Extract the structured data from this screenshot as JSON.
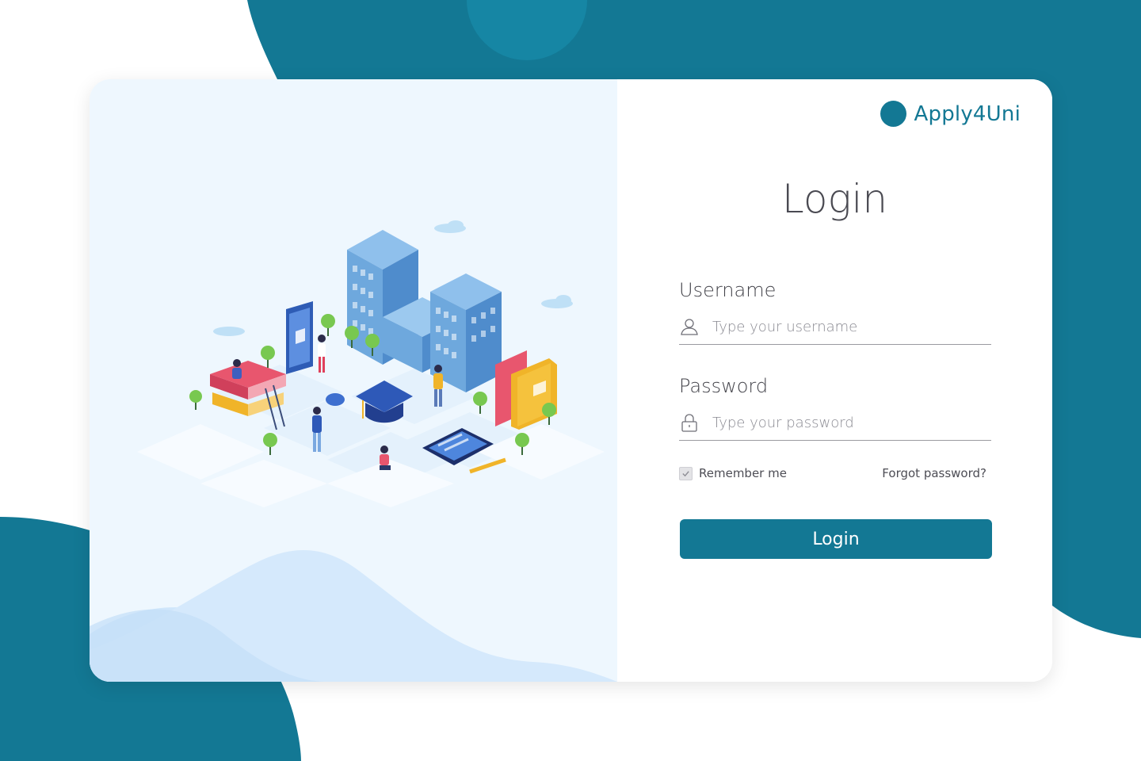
{
  "brand": {
    "name": "Apply4Uni"
  },
  "login": {
    "title": "Login",
    "username": {
      "label": "Username",
      "placeholder": "Type your username",
      "value": "",
      "icon": "user-icon"
    },
    "password": {
      "label": "Password",
      "placeholder": "Type your password",
      "value": "",
      "icon": "lock-icon"
    },
    "remember_label": "Remember me",
    "remember_checked": true,
    "forgot_label": "Forgot password?",
    "submit_label": "Login"
  },
  "colors": {
    "primary": "#137894",
    "card_left_bg": "#eef7fe",
    "text_dark": "#43434a"
  }
}
